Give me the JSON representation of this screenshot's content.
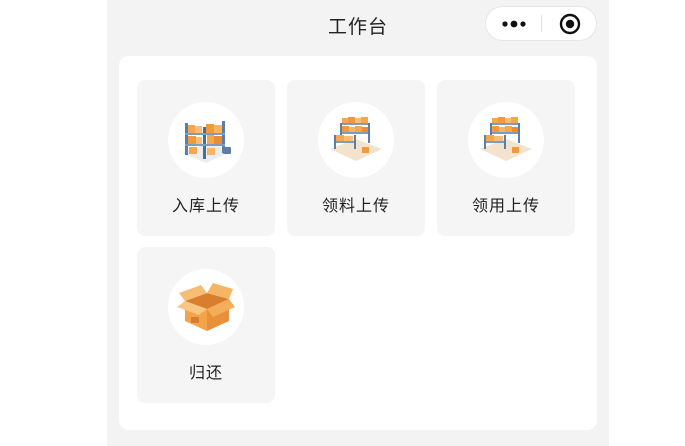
{
  "nav": {
    "title": "工作台",
    "more_icon": "more-dots-icon",
    "close_icon": "target-close-icon"
  },
  "tiles": [
    {
      "label": "入库上传",
      "icon": "warehouse-shelves-icon"
    },
    {
      "label": "领料上传",
      "icon": "warehouse-shelves-icon"
    },
    {
      "label": "领用上传",
      "icon": "warehouse-shelves-icon"
    },
    {
      "label": "归还",
      "icon": "open-box-icon"
    }
  ],
  "colors": {
    "page_bg": "#f3f3f3",
    "card_bg": "#ffffff",
    "tile_bg": "#f5f5f5",
    "accent_orange": "#f2a44a",
    "shelf_blue": "#6a8fb8"
  }
}
